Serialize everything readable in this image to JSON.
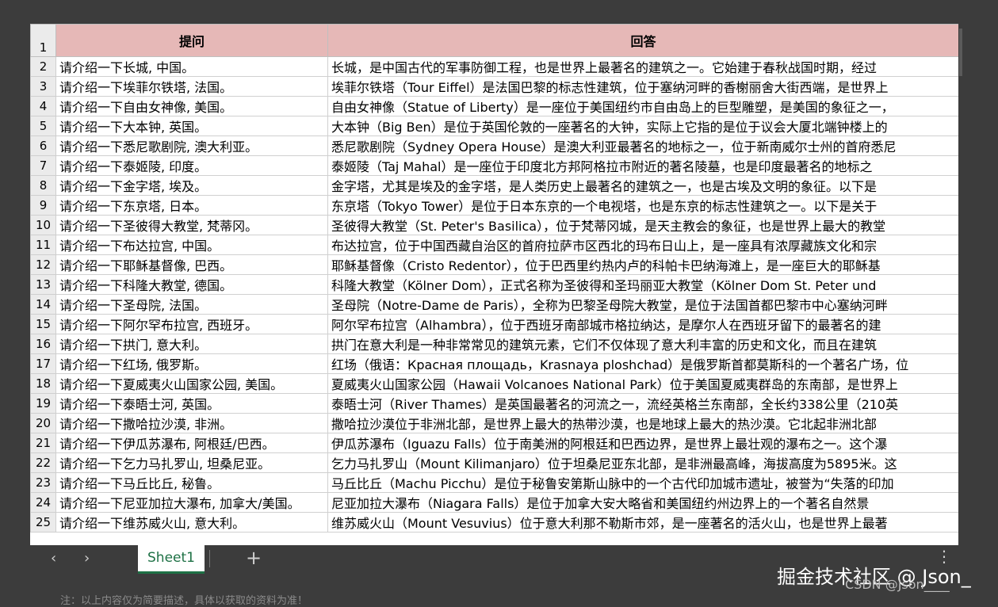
{
  "header": {
    "row_number": "1",
    "question": "提问",
    "answer": "回答"
  },
  "rows": [
    {
      "n": "2",
      "q": "请介绍一下长城, 中国。",
      "a": "长城，是中国古代的军事防御工程，也是世界上最著名的建筑之一。它始建于春秋战国时期，经过"
    },
    {
      "n": "3",
      "q": "请介绍一下埃菲尔铁塔, 法国。",
      "a": "埃菲尔铁塔（Tour Eiffel）是法国巴黎的标志性建筑，位于塞纳河畔的香榭丽舍大街西端，是世界上"
    },
    {
      "n": "4",
      "q": "请介绍一下自由女神像, 美国。",
      "a": "自由女神像（Statue of Liberty）是一座位于美国纽约市自由岛上的巨型雕塑，是美国的象征之一，"
    },
    {
      "n": "5",
      "q": "请介绍一下大本钟, 英国。",
      "a": "大本钟（Big Ben）是位于英国伦敦的一座著名的大钟，实际上它指的是位于议会大厦北端钟楼上的"
    },
    {
      "n": "6",
      "q": "请介绍一下悉尼歌剧院, 澳大利亚。",
      "a": "悉尼歌剧院（Sydney Opera House）是澳大利亚最著名的地标之一，位于新南威尔士州的首府悉尼"
    },
    {
      "n": "7",
      "q": "请介绍一下泰姬陵, 印度。",
      "a": "泰姬陵（Taj Mahal）是一座位于印度北方邦阿格拉市附近的著名陵墓，也是印度最著名的地标之"
    },
    {
      "n": "8",
      "q": "请介绍一下金字塔, 埃及。",
      "a": "金字塔，尤其是埃及的金字塔，是人类历史上最著名的建筑之一，也是古埃及文明的象征。以下是"
    },
    {
      "n": "9",
      "q": "请介绍一下东京塔, 日本。",
      "a": "东京塔（Tokyo Tower）是位于日本东京的一个电视塔，也是东京的标志性建筑之一。以下是关于"
    },
    {
      "n": "10",
      "q": "请介绍一下圣彼得大教堂, 梵蒂冈。",
      "a": "圣彼得大教堂（St. Peter's Basilica），位于梵蒂冈城，是天主教会的象征，也是世界上最大的教堂"
    },
    {
      "n": "11",
      "q": "请介绍一下布达拉宫, 中国。",
      "a": "布达拉宫，位于中国西藏自治区的首府拉萨市区西北的玛布日山上，是一座具有浓厚藏族文化和宗"
    },
    {
      "n": "12",
      "q": "请介绍一下耶稣基督像, 巴西。",
      "a": "耶稣基督像（Cristo Redentor），位于巴西里约热内卢的科帕卡巴纳海滩上，是一座巨大的耶稣基"
    },
    {
      "n": "13",
      "q": "请介绍一下科隆大教堂, 德国。",
      "a": "科隆大教堂（Kölner Dom），正式名称为圣彼得和圣玛丽亚大教堂（Kölner Dom St. Peter und"
    },
    {
      "n": "14",
      "q": "请介绍一下圣母院, 法国。",
      "a": "圣母院（Notre-Dame de Paris），全称为巴黎圣母院大教堂，是位于法国首都巴黎市中心塞纳河畔"
    },
    {
      "n": "15",
      "q": "请介绍一下阿尔罕布拉宫, 西班牙。",
      "a": "阿尔罕布拉宫（Alhambra），位于西班牙南部城市格拉纳达，是摩尔人在西班牙留下的最著名的建"
    },
    {
      "n": "16",
      "q": "请介绍一下拱门, 意大利。",
      "a": "拱门在意大利是一种非常常见的建筑元素，它们不仅体现了意大利丰富的历史和文化，而且在建筑"
    },
    {
      "n": "17",
      "q": "请介绍一下红场, 俄罗斯。",
      "a": "红场（俄语：Красная площадь，Krasnaya ploshchad）是俄罗斯首都莫斯科的一个著名广场，位"
    },
    {
      "n": "18",
      "q": "请介绍一下夏威夷火山国家公园, 美国。",
      "a": "夏威夷火山国家公园（Hawaii Volcanoes National Park）位于美国夏威夷群岛的东南部，是世界上"
    },
    {
      "n": "19",
      "q": "请介绍一下泰晤士河, 英国。",
      "a": "泰晤士河（River Thames）是英国最著名的河流之一，流经英格兰东南部，全长约338公里（210英"
    },
    {
      "n": "20",
      "q": "请介绍一下撒哈拉沙漠, 非洲。",
      "a": "撒哈拉沙漠位于非洲北部，是世界上最大的热带沙漠，也是地球上最大的热沙漠。它北起非洲北部"
    },
    {
      "n": "21",
      "q": "请介绍一下伊瓜苏瀑布, 阿根廷/巴西。",
      "a": "伊瓜苏瀑布（Iguazu Falls）位于南美洲的阿根廷和巴西边界，是世界上最壮观的瀑布之一。这个瀑"
    },
    {
      "n": "22",
      "q": "请介绍一下乞力马扎罗山, 坦桑尼亚。",
      "a": "乞力马扎罗山（Mount Kilimanjaro）位于坦桑尼亚东北部，是非洲最高峰，海拔高度为5895米。这"
    },
    {
      "n": "23",
      "q": "请介绍一下马丘比丘, 秘鲁。",
      "a": "马丘比丘（Machu Picchu）是位于秘鲁安第斯山脉中的一个古代印加城市遗址，被誉为“失落的印加"
    },
    {
      "n": "24",
      "q": "请介绍一下尼亚加拉大瀑布, 加拿大/美国。",
      "a": "尼亚加拉大瀑布（Niagara Falls）是位于加拿大安大略省和美国纽约州边界上的一个著名自然景"
    },
    {
      "n": "25",
      "q": "请介绍一下维苏威火山, 意大利。",
      "a": "维苏威火山（Mount Vesuvius）位于意大利那不勒斯市郊，是一座著名的活火山，也是世界上最著"
    }
  ],
  "tabs": {
    "sheet_name": "Sheet1",
    "add": "+",
    "more": "⋮",
    "prev": "‹",
    "next": "›"
  },
  "watermark": {
    "line1": "掘金技术社区 @ Json_",
    "line2": "CSDN @Json____"
  },
  "footer_note": "注：以上内容仅为简要描述，具体以获取的资料为准！"
}
